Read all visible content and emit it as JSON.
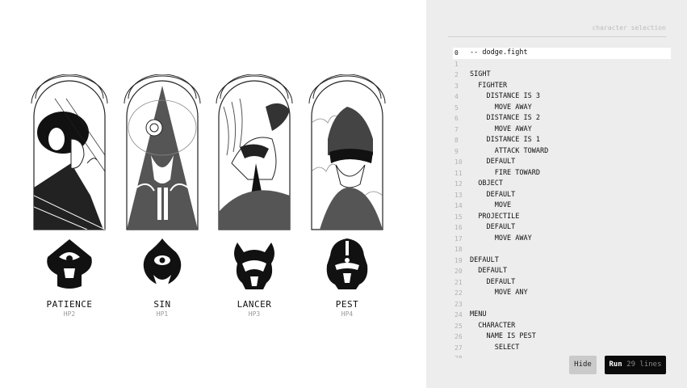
{
  "characters": [
    {
      "name": "PATIENCE",
      "hp": "HP2",
      "icon": "patience-portrait"
    },
    {
      "name": "SIN",
      "hp": "HP1",
      "icon": "sin-portrait"
    },
    {
      "name": "LANCER",
      "hp": "HP3",
      "icon": "lancer-portrait"
    },
    {
      "name": "PEST",
      "hp": "HP4",
      "icon": "pest-portrait"
    }
  ],
  "panel": {
    "title": "character selection",
    "hide_label": "Hide",
    "run_label": "Run",
    "run_count": "29 lines"
  },
  "code_lines": [
    {
      "n": "0",
      "text": "-- dodge.fight",
      "active": true
    },
    {
      "n": "1",
      "text": ""
    },
    {
      "n": "2",
      "text": "SIGHT"
    },
    {
      "n": "3",
      "text": "  FIGHTER"
    },
    {
      "n": "4",
      "text": "    DISTANCE IS 3"
    },
    {
      "n": "5",
      "text": "      MOVE AWAY"
    },
    {
      "n": "6",
      "text": "    DISTANCE IS 2"
    },
    {
      "n": "7",
      "text": "      MOVE AWAY"
    },
    {
      "n": "8",
      "text": "    DISTANCE IS 1"
    },
    {
      "n": "9",
      "text": "      ATTACK TOWARD"
    },
    {
      "n": "10",
      "text": "    DEFAULT"
    },
    {
      "n": "11",
      "text": "      FIRE TOWARD"
    },
    {
      "n": "12",
      "text": "  OBJECT"
    },
    {
      "n": "13",
      "text": "    DEFAULT"
    },
    {
      "n": "14",
      "text": "      MOVE"
    },
    {
      "n": "15",
      "text": "  PROJECTILE"
    },
    {
      "n": "16",
      "text": "    DEFAULT"
    },
    {
      "n": "17",
      "text": "      MOVE AWAY"
    },
    {
      "n": "18",
      "text": ""
    },
    {
      "n": "19",
      "text": "DEFAULT"
    },
    {
      "n": "20",
      "text": "  DEFAULT"
    },
    {
      "n": "21",
      "text": "    DEFAULT"
    },
    {
      "n": "22",
      "text": "      MOVE ANY"
    },
    {
      "n": "23",
      "text": ""
    },
    {
      "n": "24",
      "text": "MENU"
    },
    {
      "n": "25",
      "text": "  CHARACTER"
    },
    {
      "n": "26",
      "text": "    NAME IS PEST"
    },
    {
      "n": "27",
      "text": "      SELECT"
    },
    {
      "n": "28",
      "text": ""
    }
  ]
}
